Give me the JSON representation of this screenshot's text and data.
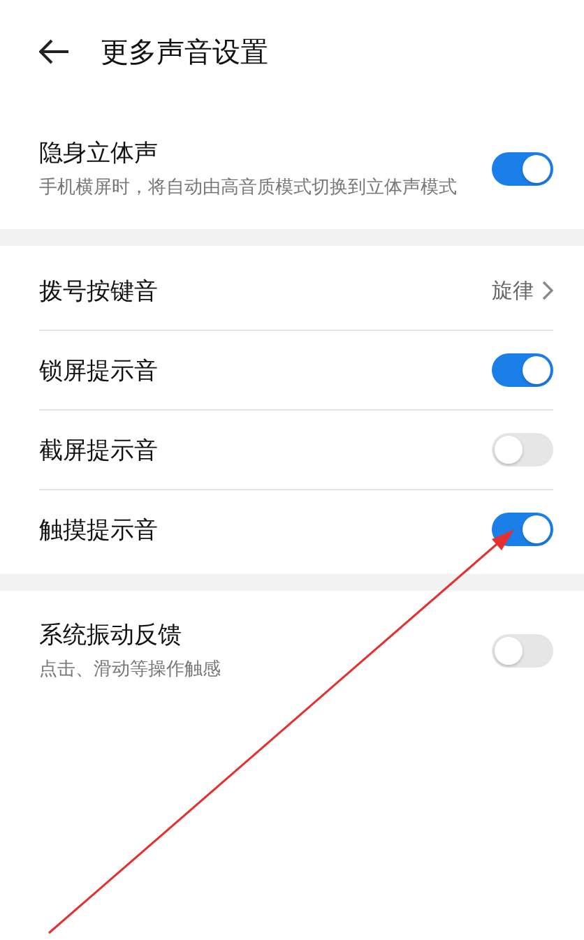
{
  "header": {
    "title": "更多声音设置"
  },
  "sections": [
    {
      "rows": [
        {
          "kind": "toggle",
          "label": "隐身立体声",
          "description": "手机横屏时，将自动由高音质模式切换到立体声模式",
          "on": true
        }
      ]
    },
    {
      "rows": [
        {
          "kind": "link",
          "label": "拨号按键音",
          "value": "旋律"
        },
        {
          "kind": "toggle",
          "label": "锁屏提示音",
          "on": true
        },
        {
          "kind": "toggle",
          "label": "截屏提示音",
          "on": false
        },
        {
          "kind": "toggle",
          "label": "触摸提示音",
          "on": true
        }
      ]
    },
    {
      "rows": [
        {
          "kind": "toggle",
          "label": "系统振动反馈",
          "description": "点击、滑动等操作触感",
          "on": false
        }
      ]
    }
  ]
}
